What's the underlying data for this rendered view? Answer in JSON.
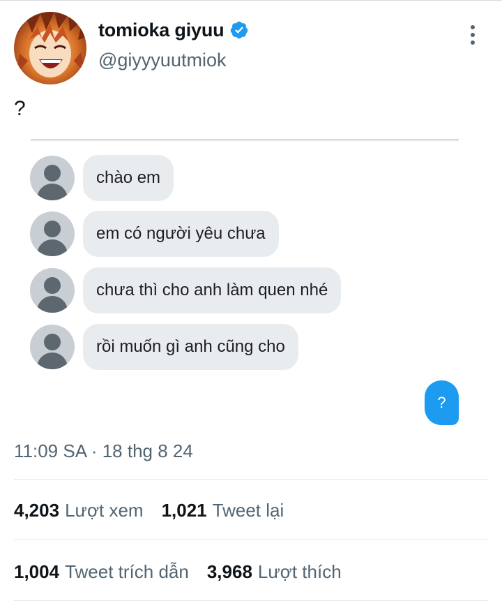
{
  "tweet": {
    "author": {
      "display_name": "tomioka giyuu",
      "handle": "@giyyyuutmiok",
      "verified": true
    },
    "text": "?",
    "timestamp": "11:09 SA · 18 thg 8 24",
    "stats_row_1": [
      {
        "count": "4,203",
        "label": "Lượt xem"
      },
      {
        "count": "1,021",
        "label": "Tweet lại"
      }
    ],
    "stats_row_2": [
      {
        "count": "1,004",
        "label": "Tweet trích dẫn"
      },
      {
        "count": "3,968",
        "label": "Lượt thích"
      }
    ]
  },
  "chat": {
    "received_messages": [
      "chào em",
      "em có người yêu chưa",
      "chưa thì cho anh làm quen nhé",
      "rồi muốn gì anh cũng cho"
    ],
    "sent_message": "?"
  },
  "colors": {
    "accent": "#1d9bf0",
    "secondary_text": "#536471",
    "bubble_bg": "#e9ecef",
    "placeholder_avatar": "#c8ced3"
  },
  "icons": {
    "verified": "verified-badge-icon",
    "more": "more-vertical-icon",
    "chat_avatar": "default-user-icon"
  }
}
